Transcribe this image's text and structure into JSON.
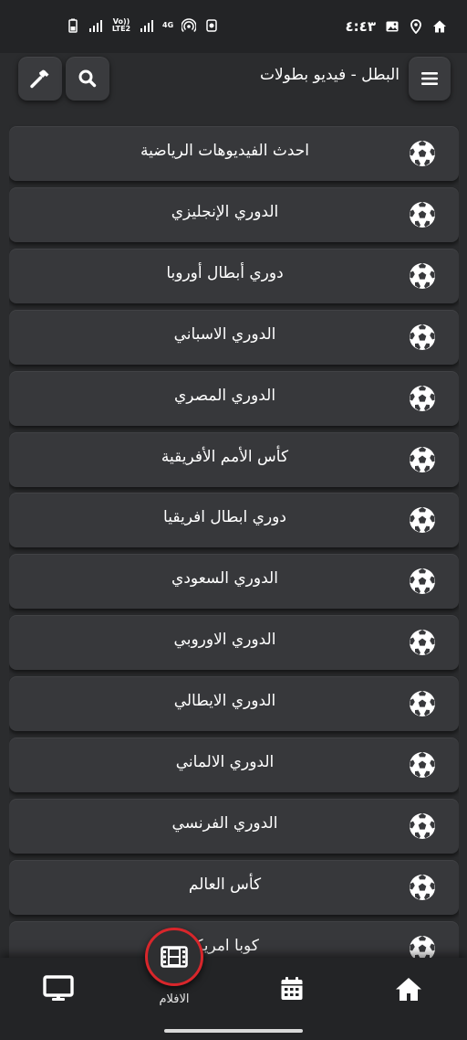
{
  "status_bar": {
    "time": "٤:٤٣",
    "signal_text_1": "Vo)) LTE2",
    "signal_text_2": "4G"
  },
  "app_bar": {
    "title": "البطل - فيديو بطولات",
    "icons": [
      "hammer-icon",
      "search-icon",
      "menu-icon"
    ]
  },
  "leagues": [
    {
      "label": "احدث الفيديوهات الرياضية"
    },
    {
      "label": "الدوري الإنجليزي"
    },
    {
      "label": "دوري أبطال أوروبا"
    },
    {
      "label": "الدوري الاسباني"
    },
    {
      "label": "الدوري المصري"
    },
    {
      "label": "كأس الأمم الأفريقية"
    },
    {
      "label": "دوري ابطال افريقيا"
    },
    {
      "label": "الدوري السعودي"
    },
    {
      "label": "الدوري الاوروبي"
    },
    {
      "label": "الدوري الايطالي"
    },
    {
      "label": "الدوري الالماني"
    },
    {
      "label": "الدوري الفرنسي"
    },
    {
      "label": "كأس العالم"
    },
    {
      "label": "كوبا امريكا"
    }
  ],
  "bottom_nav": {
    "films_label": "الافلام",
    "icons": [
      "tv-icon",
      "film-icon",
      "calendar-icon",
      "home-icon"
    ]
  },
  "colors": {
    "background": "#2b2c2e",
    "card": "#37383b",
    "accent_ring": "#d8262b"
  }
}
